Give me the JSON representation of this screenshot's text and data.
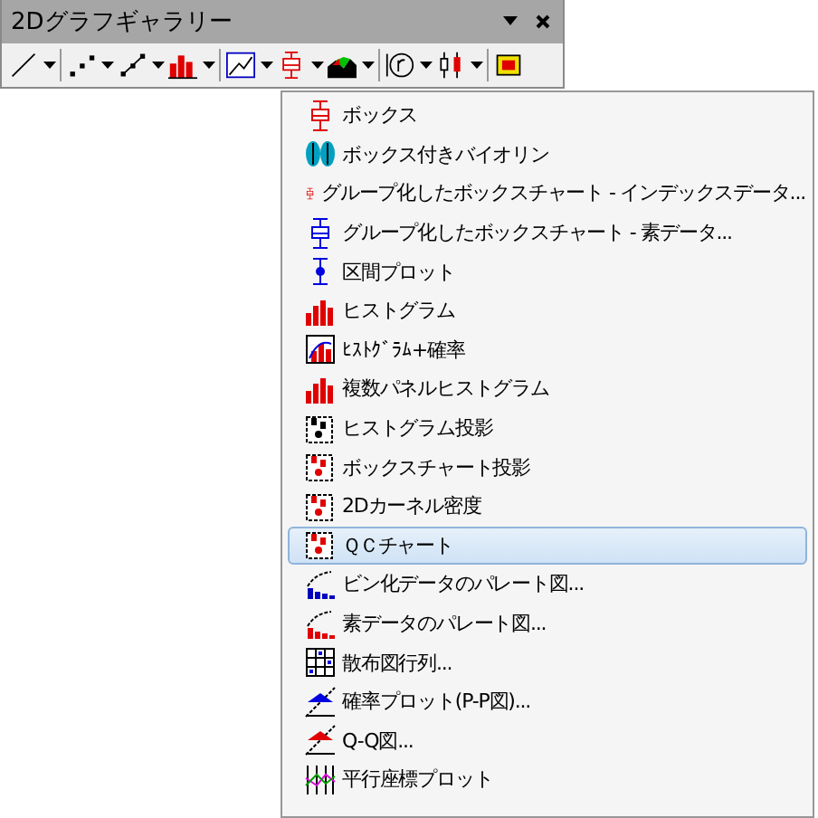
{
  "window": {
    "title": "2Dグラフギャラリー"
  },
  "toolbar": [
    {
      "dropdown": true
    },
    {
      "dropdown": true
    },
    {
      "dropdown": true
    },
    {
      "dropdown": true
    },
    {
      "dropdown": true
    },
    {
      "dropdown": true
    },
    {
      "dropdown": true
    },
    {
      "dropdown": true
    },
    {
      "dropdown": true
    },
    {
      "dropdown": false
    }
  ],
  "menu": [
    {
      "label": "ボックス",
      "selected": false
    },
    {
      "label": "ボックス付きバイオリン",
      "selected": false
    },
    {
      "label": "グループ化したボックスチャート - インデックスデータ...",
      "selected": false
    },
    {
      "label": "グループ化したボックスチャート - 素データ...",
      "selected": false
    },
    {
      "label": "区間プロット",
      "selected": false
    },
    {
      "label": "ヒストグラム",
      "selected": false
    },
    {
      "label": "ﾋｽﾄｸﾞﾗﾑ+確率",
      "selected": false
    },
    {
      "label": "複数パネルヒストグラム",
      "selected": false
    },
    {
      "label": "ヒストグラム投影",
      "selected": false
    },
    {
      "label": "ボックスチャート投影",
      "selected": false
    },
    {
      "label": "2Dカーネル密度",
      "selected": false
    },
    {
      "label": "ＱＣチャート",
      "selected": true
    },
    {
      "label": "ビン化データのパレート図...",
      "selected": false
    },
    {
      "label": "素データのパレート図...",
      "selected": false
    },
    {
      "label": "散布図行列...",
      "selected": false
    },
    {
      "label": "確率プロット(P-P図)...",
      "selected": false
    },
    {
      "label": "Q-Q図...",
      "selected": false
    },
    {
      "label": "平行座標プロット",
      "selected": false
    }
  ]
}
